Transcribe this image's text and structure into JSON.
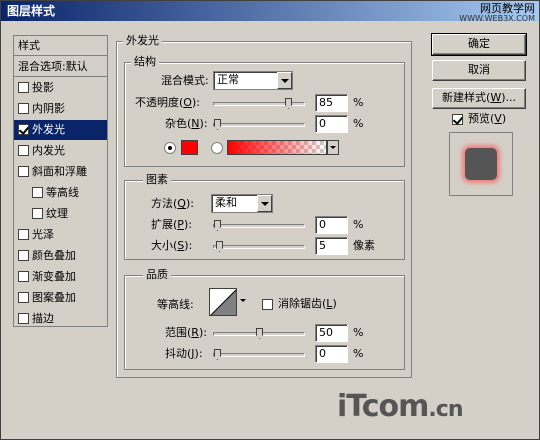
{
  "window": {
    "title": "图层样式",
    "watermark_text": "网页教学网",
    "watermark_url": "WWW.WEB3X.COM"
  },
  "sidebar": {
    "items": [
      {
        "label": "样式",
        "checkbox": false,
        "checked": false,
        "active": false
      },
      {
        "label": "混合选项:默认",
        "checkbox": false,
        "checked": false,
        "active": false
      },
      {
        "label": "投影",
        "checkbox": true,
        "checked": false,
        "active": false
      },
      {
        "label": "内阴影",
        "checkbox": true,
        "checked": false,
        "active": false
      },
      {
        "label": "外发光",
        "checkbox": true,
        "checked": true,
        "active": true
      },
      {
        "label": "内发光",
        "checkbox": true,
        "checked": false,
        "active": false
      },
      {
        "label": "斜面和浮雕",
        "checkbox": true,
        "checked": false,
        "active": false
      },
      {
        "label": "等高线",
        "checkbox": true,
        "checked": false,
        "active": false
      },
      {
        "label": "纹理",
        "checkbox": true,
        "checked": false,
        "active": false
      },
      {
        "label": "光泽",
        "checkbox": true,
        "checked": false,
        "active": false
      },
      {
        "label": "颜色叠加",
        "checkbox": true,
        "checked": false,
        "active": false
      },
      {
        "label": "渐变叠加",
        "checkbox": true,
        "checked": false,
        "active": false
      },
      {
        "label": "图案叠加",
        "checkbox": true,
        "checked": false,
        "active": false
      },
      {
        "label": "描边",
        "checkbox": true,
        "checked": false,
        "active": false
      }
    ]
  },
  "outer_glow": {
    "title": "外发光",
    "structure": {
      "title": "结构",
      "blend_mode_label": "混合模式:",
      "blend_mode_value": "正常",
      "opacity_label": "不透明度(",
      "opacity_key": "O",
      "opacity_label_end": "):",
      "opacity_value": "85",
      "opacity_unit": "%",
      "opacity_fraction": 0.85,
      "noise_label": "杂色(",
      "noise_key": "N",
      "noise_label_end": "):",
      "noise_value": "0",
      "noise_unit": "%",
      "noise_fraction": 0,
      "color_hex": "#ff0000"
    },
    "elements": {
      "title": "图素",
      "method_label": "方法(",
      "method_key": "Q",
      "method_label_end": "):",
      "method_value": "柔和",
      "spread_label": "扩展(",
      "spread_key": "P",
      "spread_label_end": "):",
      "spread_value": "0",
      "spread_unit": "%",
      "spread_fraction": 0,
      "size_label": "大小(",
      "size_key": "S",
      "size_label_end": "):",
      "size_value": "5",
      "size_unit": "像素",
      "size_fraction": 0.02
    },
    "quality": {
      "title": "品质",
      "contour_label": "等高线:",
      "antialias_label": "消除锯齿(",
      "antialias_key": "L",
      "antialias_label_end": ")",
      "antialias_checked": false,
      "range_label": "范围(",
      "range_key": "R",
      "range_label_end": "):",
      "range_value": "50",
      "range_unit": "%",
      "range_fraction": 0.5,
      "jitter_label": "抖动(",
      "jitter_key": "J",
      "jitter_label_end": "):",
      "jitter_value": "0",
      "jitter_unit": "%",
      "jitter_fraction": 0
    }
  },
  "buttons": {
    "ok": "确定",
    "cancel": "取消",
    "new_style": "新建样式(",
    "new_style_key": "W",
    "new_style_end": ")...",
    "preview_label": "预览(",
    "preview_key": "V",
    "preview_end": ")",
    "preview_checked": true
  },
  "logo": {
    "text": "iTcom",
    "suffix": ".cn"
  }
}
